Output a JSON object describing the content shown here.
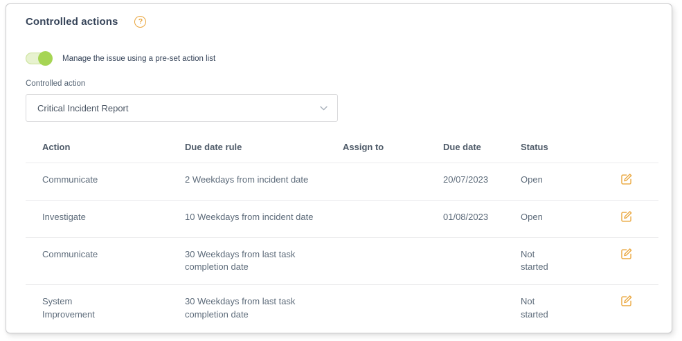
{
  "colors": {
    "accent": "#E9A53C",
    "toggle_track": "#E7F2CF",
    "toggle_track_border": "#C8E194",
    "toggle_knob": "#A6D554",
    "title_text": "#37455A",
    "body_text": "#5D6B7A",
    "header_text": "#4E5A68",
    "card_border": "#CBCBCD",
    "divider": "#EBEBED",
    "field_border": "#D9D9DB"
  },
  "panel": {
    "title": "Controlled actions",
    "help_glyph": "?"
  },
  "toggle": {
    "label": "Manage the issue using a pre-set action list",
    "state": "on"
  },
  "controlled_action": {
    "label": "Controlled action",
    "selected_value": "Critical Incident Report"
  },
  "table": {
    "columns": [
      "Action",
      "Due date rule",
      "Assign to",
      "Due date",
      "Status"
    ],
    "rows": [
      {
        "action": "Communicate",
        "due_date_rule": "2 Weekdays from incident date",
        "assign_to": "",
        "due_date": "20/07/2023",
        "status": "Open"
      },
      {
        "action": "Investigate",
        "due_date_rule": "10 Weekdays from incident date",
        "assign_to": "",
        "due_date": "01/08/2023",
        "status": "Open"
      },
      {
        "action": "Communicate",
        "due_date_rule": "30 Weekdays from last task completion date",
        "assign_to": "",
        "due_date": "",
        "status": "Not started"
      },
      {
        "action": "System Improvement",
        "due_date_rule": "30 Weekdays from last task completion date",
        "assign_to": "",
        "due_date": "",
        "status": "Not started"
      }
    ]
  },
  "icons": {
    "help": "help-circle-icon",
    "chevron": "chevron-down-icon",
    "edit": "edit-icon"
  }
}
